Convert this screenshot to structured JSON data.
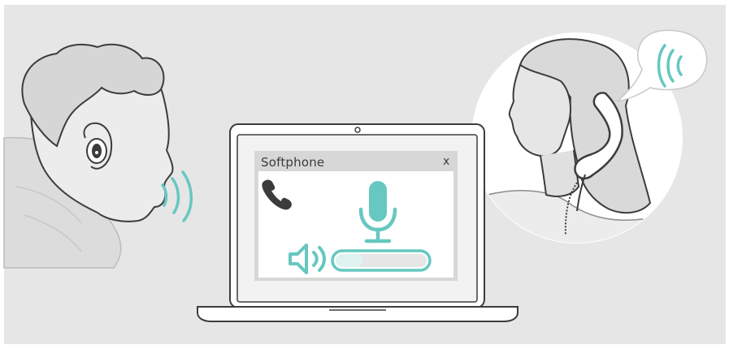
{
  "softphone": {
    "title": "Softphone",
    "close_label": "x",
    "volume_level": 0.3
  },
  "icons": {
    "earbud": "earbud-icon",
    "microphone": "microphone-icon",
    "speaker": "speaker-icon",
    "handset": "phone-handset-icon",
    "sound_waves": "sound-waves-icon"
  },
  "colors": {
    "background": "#e6e6e6",
    "accent": "#66c8c0",
    "outline": "#3c3c3c",
    "panel": "#f2f2f2",
    "window": "#ffffff"
  }
}
